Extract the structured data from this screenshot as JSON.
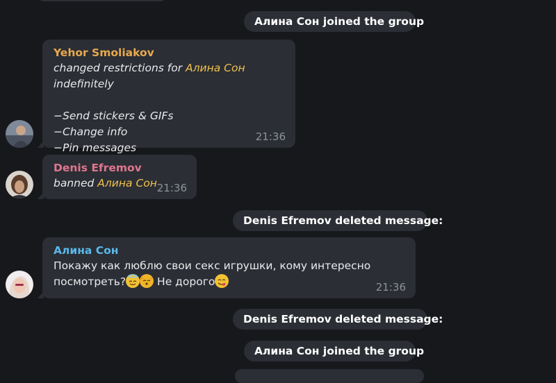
{
  "colors": {
    "background": "#17181c",
    "bubble": "#2b2e34",
    "yehor_name": "#e8a94e",
    "denis_name": "#e0768f",
    "alina_name": "#5ab8ea",
    "highlight": "#f2c04d",
    "time": "#8d939b"
  },
  "service": {
    "joined_1": "Алина Сон joined the group",
    "deleted_1": "Denis Efremov deleted message:",
    "deleted_2": "Denis Efremov deleted message:",
    "joined_2": "Алина Сон joined the group"
  },
  "msg_yehor": {
    "sender": "Yehor Smoliakov",
    "text_prefix": "changed restrictions for ",
    "target": "Алина Сон",
    "text_suffix": " indefinitely",
    "restrictions": [
      "−Send stickers & GIFs",
      "−Change info",
      "−Pin messages"
    ],
    "time": "21:36",
    "avatar_icon": "user-avatar-photo"
  },
  "msg_denis": {
    "sender": "Denis Efremov",
    "text_prefix": "banned ",
    "target": "Алина Сон",
    "time": "21:36",
    "avatar_icon": "user-avatar-photo"
  },
  "msg_alina": {
    "sender": "Алина Сон",
    "line1": "Покажу как люблю свои секс игрушки, кому интересно",
    "line2_text": "посмотреть?",
    "line2_after": " Не дорого",
    "emojis": [
      "smiling-face-with-halo-emoji",
      "kissing-cat-emoji",
      "face-savoring-food-emoji"
    ],
    "time": "21:36",
    "avatar_icon": "user-avatar-photo"
  }
}
